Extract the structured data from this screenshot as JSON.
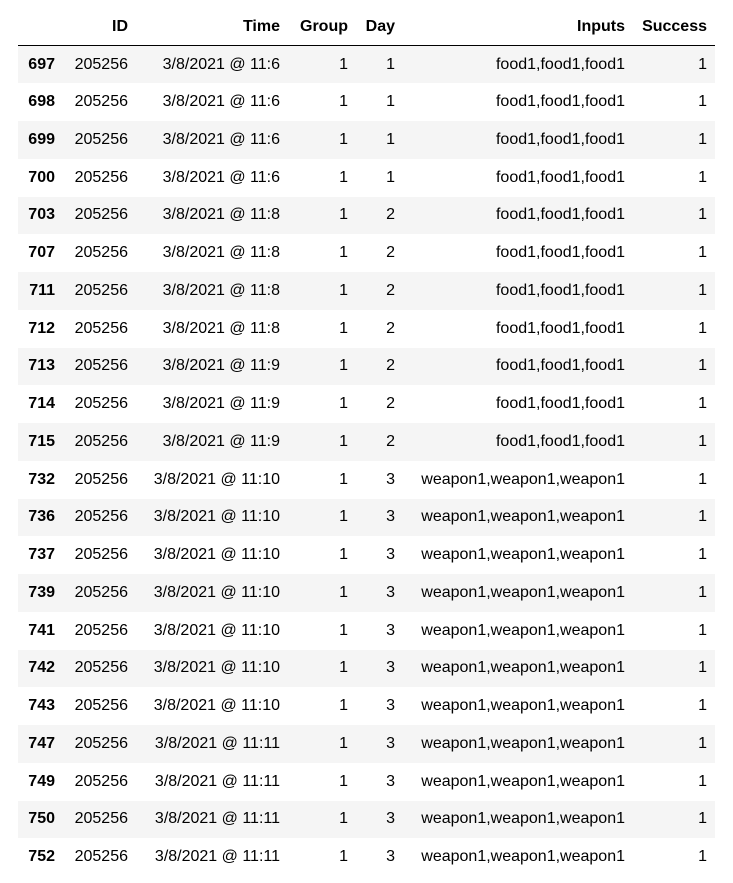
{
  "table": {
    "columns": [
      "",
      "ID",
      "Time",
      "Group",
      "Day",
      "Inputs",
      "Success"
    ],
    "rows": [
      [
        "697",
        "205256",
        "3/8/2021 @ 11:6",
        "1",
        "1",
        "food1,food1,food1",
        "1"
      ],
      [
        "698",
        "205256",
        "3/8/2021 @ 11:6",
        "1",
        "1",
        "food1,food1,food1",
        "1"
      ],
      [
        "699",
        "205256",
        "3/8/2021 @ 11:6",
        "1",
        "1",
        "food1,food1,food1",
        "1"
      ],
      [
        "700",
        "205256",
        "3/8/2021 @ 11:6",
        "1",
        "1",
        "food1,food1,food1",
        "1"
      ],
      [
        "703",
        "205256",
        "3/8/2021 @ 11:8",
        "1",
        "2",
        "food1,food1,food1",
        "1"
      ],
      [
        "707",
        "205256",
        "3/8/2021 @ 11:8",
        "1",
        "2",
        "food1,food1,food1",
        "1"
      ],
      [
        "711",
        "205256",
        "3/8/2021 @ 11:8",
        "1",
        "2",
        "food1,food1,food1",
        "1"
      ],
      [
        "712",
        "205256",
        "3/8/2021 @ 11:8",
        "1",
        "2",
        "food1,food1,food1",
        "1"
      ],
      [
        "713",
        "205256",
        "3/8/2021 @ 11:9",
        "1",
        "2",
        "food1,food1,food1",
        "1"
      ],
      [
        "714",
        "205256",
        "3/8/2021 @ 11:9",
        "1",
        "2",
        "food1,food1,food1",
        "1"
      ],
      [
        "715",
        "205256",
        "3/8/2021 @ 11:9",
        "1",
        "2",
        "food1,food1,food1",
        "1"
      ],
      [
        "732",
        "205256",
        "3/8/2021 @ 11:10",
        "1",
        "3",
        "weapon1,weapon1,weapon1",
        "1"
      ],
      [
        "736",
        "205256",
        "3/8/2021 @ 11:10",
        "1",
        "3",
        "weapon1,weapon1,weapon1",
        "1"
      ],
      [
        "737",
        "205256",
        "3/8/2021 @ 11:10",
        "1",
        "3",
        "weapon1,weapon1,weapon1",
        "1"
      ],
      [
        "739",
        "205256",
        "3/8/2021 @ 11:10",
        "1",
        "3",
        "weapon1,weapon1,weapon1",
        "1"
      ],
      [
        "741",
        "205256",
        "3/8/2021 @ 11:10",
        "1",
        "3",
        "weapon1,weapon1,weapon1",
        "1"
      ],
      [
        "742",
        "205256",
        "3/8/2021 @ 11:10",
        "1",
        "3",
        "weapon1,weapon1,weapon1",
        "1"
      ],
      [
        "743",
        "205256",
        "3/8/2021 @ 11:10",
        "1",
        "3",
        "weapon1,weapon1,weapon1",
        "1"
      ],
      [
        "747",
        "205256",
        "3/8/2021 @ 11:11",
        "1",
        "3",
        "weapon1,weapon1,weapon1",
        "1"
      ],
      [
        "749",
        "205256",
        "3/8/2021 @ 11:11",
        "1",
        "3",
        "weapon1,weapon1,weapon1",
        "1"
      ],
      [
        "750",
        "205256",
        "3/8/2021 @ 11:11",
        "1",
        "3",
        "weapon1,weapon1,weapon1",
        "1"
      ],
      [
        "752",
        "205256",
        "3/8/2021 @ 11:11",
        "1",
        "3",
        "weapon1,weapon1,weapon1",
        "1"
      ]
    ]
  }
}
